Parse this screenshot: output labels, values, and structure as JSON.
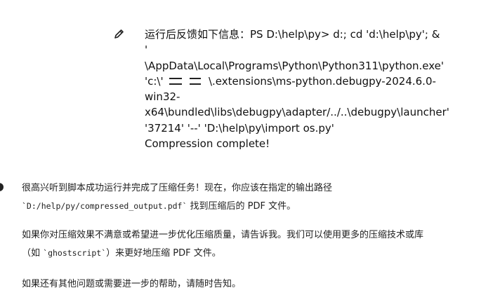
{
  "user_message": {
    "edit_icon": "pencil-icon",
    "lines": [
      "运行后反馈如下信息：PS D:\\help\\py>  d:; cd 'd:\\help\\py'; &",
      "'",
      "\\AppData\\Local\\Programs\\Python\\Python311\\python.exe'",
      "'c:\\'",
      "\\.extensions\\ms-python.debugpy-2024.6.0-",
      "win32-",
      "x64\\bundled\\libs\\debugpy\\adapter/../..\\debugpy\\launcher'",
      "'37214' '--' 'D:\\help\\py\\import os.py'",
      "Compression complete!"
    ]
  },
  "assistant_reply": {
    "p1_line1": "很高兴听到脚本成功运行并完成了压缩任务！现在，你应该在指定的输出路径",
    "p1_code": "`D:/help/py/compressed_output.pdf`",
    "p1_rest": " 找到压缩后的 PDF 文件。",
    "p2_line1": "如果你对压缩效果不满意或希望进一步优化压缩质量，请告诉我。我们可以使用更多的压缩技术或库",
    "p2_pre": "（如 ",
    "p2_code": "`ghostscript`",
    "p2_post": "）来更好地压缩 PDF 文件。",
    "p3_line1": "如果还有其他问题或需要进一步的帮助，请随时告知。"
  }
}
